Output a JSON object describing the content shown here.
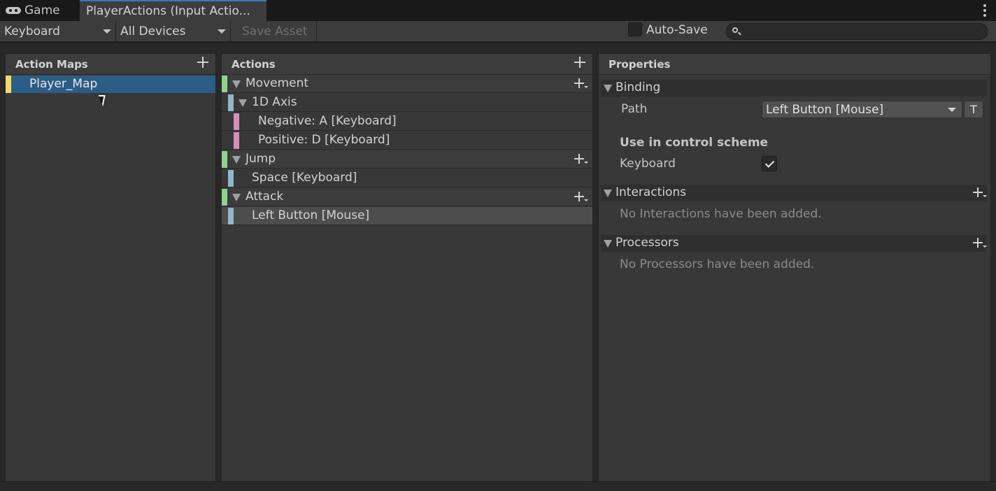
{
  "tabs": [
    {
      "label": "Game",
      "icon": "gamepad-icon"
    },
    {
      "label": "PlayerActions (Input Actio...",
      "active": true
    }
  ],
  "toolbar": {
    "control_scheme": "Keyboard",
    "devices": "All Devices",
    "save_asset": "Save Asset",
    "auto_save_label": "Auto-Save",
    "auto_save_checked": false,
    "search_value": ""
  },
  "action_maps": {
    "header": "Action Maps",
    "items": [
      {
        "label": "Player_Map",
        "selected": true,
        "color": "#f3d96c"
      }
    ]
  },
  "actions": {
    "header": "Actions",
    "rows": [
      {
        "label": "Movement",
        "kind": "action",
        "color": "#8fd18f"
      },
      {
        "label": "1D Axis",
        "kind": "composite",
        "color": "#8fb8c9"
      },
      {
        "label": "Negative: A [Keyboard]",
        "kind": "part",
        "color": "#d68fb4"
      },
      {
        "label": "Positive: D [Keyboard]",
        "kind": "part",
        "color": "#d68fb4"
      },
      {
        "label": "Jump",
        "kind": "action",
        "color": "#8fd18f"
      },
      {
        "label": "Space [Keyboard]",
        "kind": "binding",
        "color": "#8fb8c9"
      },
      {
        "label": "Attack",
        "kind": "action",
        "color": "#8fd18f"
      },
      {
        "label": "Left Button [Mouse]",
        "kind": "binding",
        "color": "#8fb8c9",
        "selected": true
      }
    ]
  },
  "properties": {
    "header": "Properties",
    "binding_section": "Binding",
    "path_label": "Path",
    "path_value": "Left Button [Mouse]",
    "t_button": "T",
    "control_scheme_heading": "Use in control scheme",
    "scheme_keyboard": "Keyboard",
    "scheme_keyboard_checked": true,
    "interactions_section": "Interactions",
    "interactions_empty": "No Interactions have been added.",
    "processors_section": "Processors",
    "processors_empty": "No Processors have been added."
  },
  "colors": {
    "selection": "#2c5d87",
    "action_bar": "#8fd18f",
    "binding_bar": "#8fb8c9",
    "part_bar": "#d68fb4",
    "map_bar": "#f3d96c",
    "active_tab_accent": "#3a79bb"
  }
}
